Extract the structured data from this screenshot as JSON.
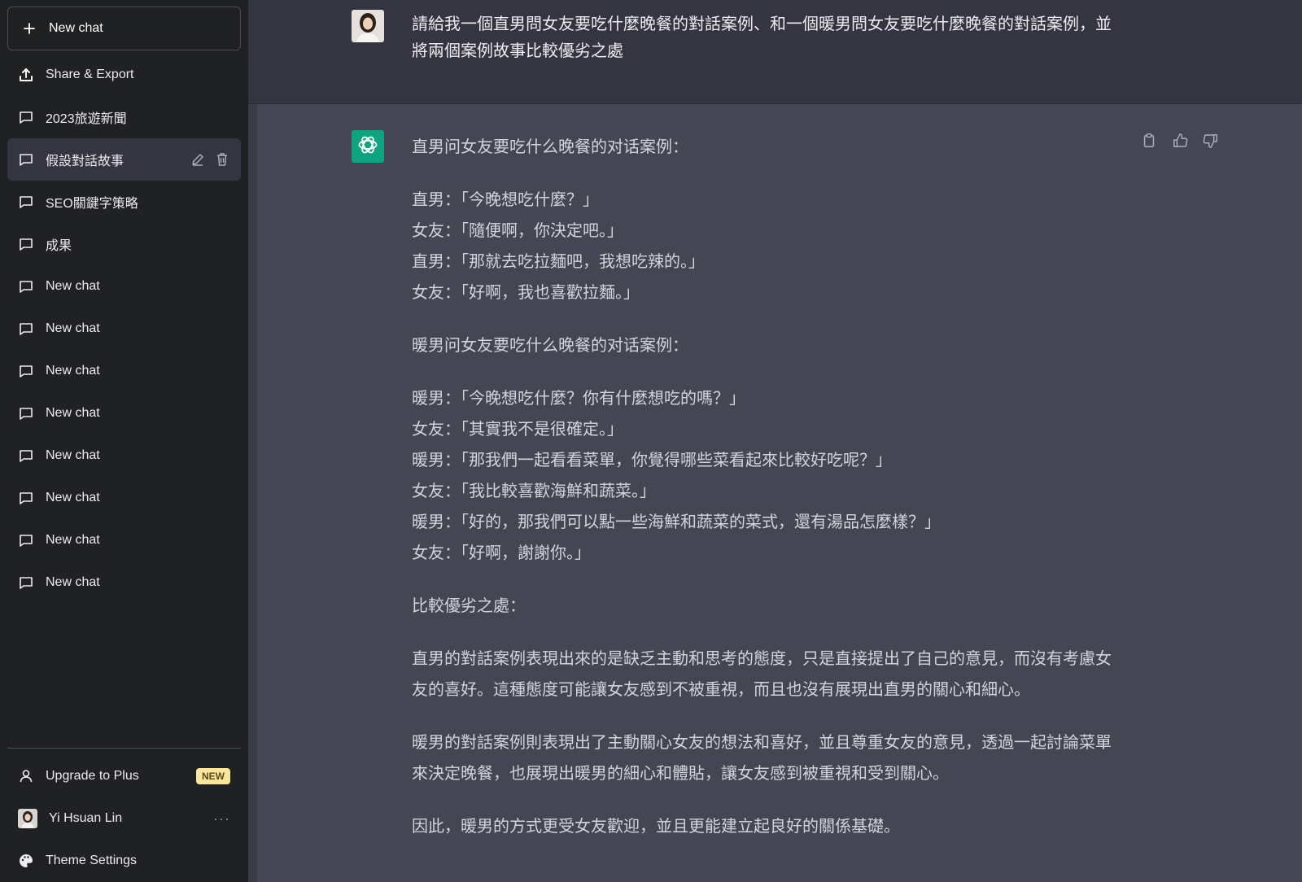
{
  "sidebar": {
    "new_chat": "New chat",
    "share_export": "Share & Export",
    "conversations": [
      {
        "label": "2023旅遊新聞",
        "active": false
      },
      {
        "label": "假設對話故事",
        "active": true
      },
      {
        "label": "SEO關鍵字策略",
        "active": false
      },
      {
        "label": "成果",
        "active": false
      },
      {
        "label": "New chat",
        "active": false
      },
      {
        "label": "New chat",
        "active": false
      },
      {
        "label": "New chat",
        "active": false
      },
      {
        "label": "New chat",
        "active": false
      },
      {
        "label": "New chat",
        "active": false
      },
      {
        "label": "New chat",
        "active": false
      },
      {
        "label": "New chat",
        "active": false
      },
      {
        "label": "New chat",
        "active": false
      }
    ],
    "upgrade": "Upgrade to Plus",
    "upgrade_badge": "NEW",
    "user_name": "Yi Hsuan Lin",
    "user_menu": "···",
    "theme_settings": "Theme Settings"
  },
  "conversation": {
    "user_message": "請給我一個直男問女友要吃什麼晚餐的對話案例、和一個暖男問女友要吃什麼晚餐的對話案例，並將兩個案例故事比較優劣之處",
    "bot": {
      "heading1": "直男问女友要吃什么晚餐的对话案例：",
      "dialog1": [
        "直男：「今晚想吃什麼？」",
        "女友：「隨便啊，你決定吧。」",
        "直男：「那就去吃拉麵吧，我想吃辣的。」",
        "女友：「好啊，我也喜歡拉麵。」"
      ],
      "heading2": "暖男问女友要吃什么晚餐的对话案例：",
      "dialog2": [
        "暖男：「今晚想吃什麼？你有什麼想吃的嗎？」",
        "女友：「其實我不是很確定。」",
        "暖男：「那我們一起看看菜單，你覺得哪些菜看起來比較好吃呢？」",
        "女友：「我比較喜歡海鮮和蔬菜。」",
        "暖男：「好的，那我們可以點一些海鮮和蔬菜的菜式，還有湯品怎麼樣？」",
        "女友：「好啊，謝謝你。」"
      ],
      "heading3": "比較優劣之處：",
      "para1": "直男的對話案例表現出來的是缺乏主動和思考的態度，只是直接提出了自己的意見，而沒有考慮女友的喜好。這種態度可能讓女友感到不被重視，而且也沒有展現出直男的關心和細心。",
      "para2": "暖男的對話案例則表現出了主動關心女友的想法和喜好，並且尊重女友的意見，透過一起討論菜單來決定晚餐，也展現出暖男的細心和體貼，讓女友感到被重視和受到關心。",
      "para3": "因此，暖男的方式更受女友歡迎，並且更能建立起良好的關係基礎。"
    }
  },
  "colors": {
    "sidebar_bg": "#202123",
    "main_bg": "#444654",
    "user_bg": "#343541",
    "accent": "#10a37f",
    "badge": "#fae69e"
  }
}
